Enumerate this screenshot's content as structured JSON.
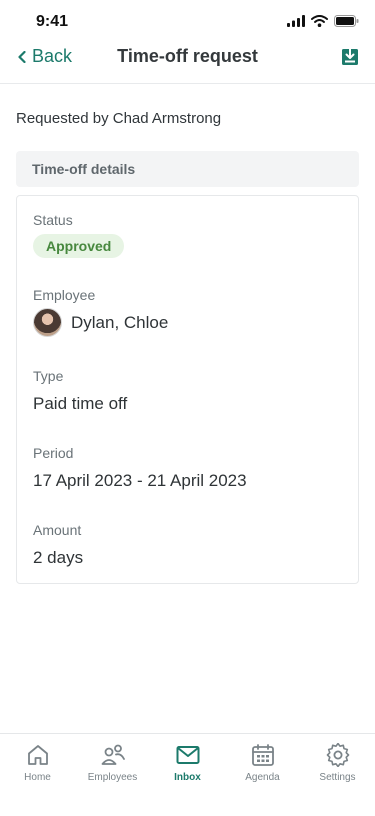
{
  "status_bar": {
    "time": "9:41",
    "icons": [
      "signal-icon",
      "wifi-icon",
      "battery-icon"
    ]
  },
  "header": {
    "back_label": "Back",
    "title": "Time-off request",
    "download_icon": "download-icon"
  },
  "requested_by": "Requested by Chad Armstrong",
  "section_title": "Time-off details",
  "details": {
    "status_label": "Status",
    "status_value": "Approved",
    "employee_label": "Employee",
    "employee_name": "Dylan, Chloe",
    "type_label": "Type",
    "type_value": "Paid time off",
    "period_label": "Period",
    "period_value": "17 April 2023 - 21 April 2023",
    "amount_label": "Amount",
    "amount_value": "2 days"
  },
  "tabs": [
    {
      "label": "Home",
      "icon": "home-icon",
      "active": false
    },
    {
      "label": "Employees",
      "icon": "employees-icon",
      "active": false
    },
    {
      "label": "Inbox",
      "icon": "inbox-icon",
      "active": true
    },
    {
      "label": "Agenda",
      "icon": "calendar-icon",
      "active": false
    },
    {
      "label": "Settings",
      "icon": "gear-icon",
      "active": false
    }
  ],
  "colors": {
    "accent": "#1c7a6b",
    "approved_bg": "#e7f4e4",
    "approved_text": "#47883e"
  }
}
